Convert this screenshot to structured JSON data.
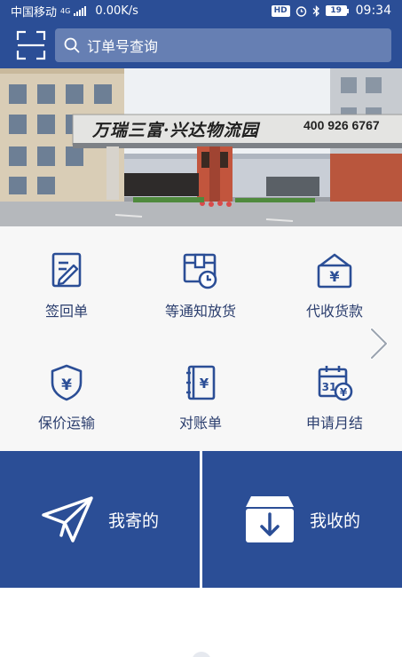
{
  "status_bar": {
    "carrier": "中国移动",
    "network_type": "4G",
    "speed": "0.00K/s",
    "hd": "HD",
    "battery": "19",
    "time": "09:34"
  },
  "header": {
    "search_placeholder": "订单号查询"
  },
  "banner": {
    "gate_sign": "万瑞三富·兴达物流园",
    "phone": "400 926 6767"
  },
  "services": {
    "items": [
      {
        "label": "签回单",
        "icon": "signed-receipt-icon"
      },
      {
        "label": "等通知放货",
        "icon": "release-notice-icon"
      },
      {
        "label": "代收货款",
        "icon": "collection-payment-icon"
      },
      {
        "label": "保价运输",
        "icon": "insured-shipping-icon"
      },
      {
        "label": "对账单",
        "icon": "statement-icon"
      },
      {
        "label": "申请月结",
        "icon": "monthly-settlement-icon"
      }
    ],
    "next_icon": "chevron-right-icon"
  },
  "tiles": {
    "send_label": "我寄的",
    "receive_label": "我收的"
  },
  "colors": {
    "primary": "#2b4e96",
    "icon": "#2b4e96",
    "label": "#2b3e6e",
    "grid_bg": "#f7f7f7"
  }
}
